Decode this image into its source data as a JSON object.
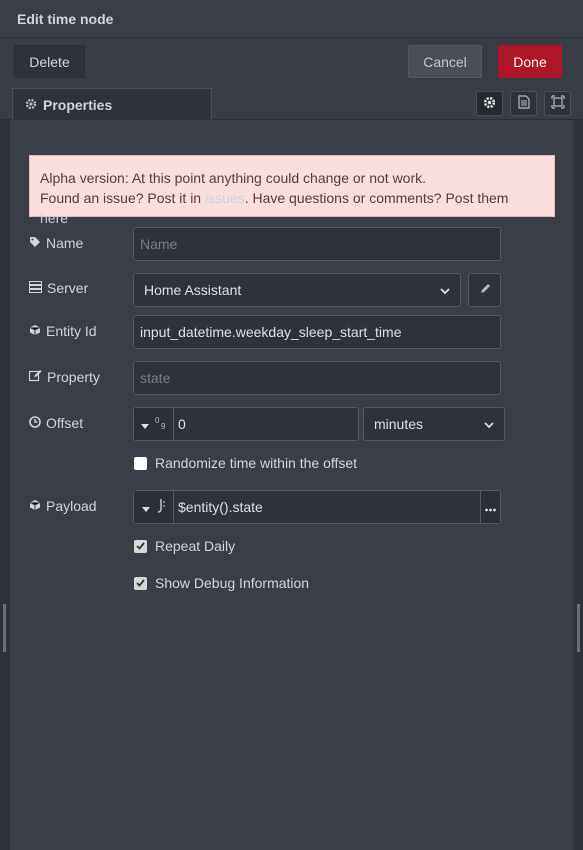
{
  "window": {
    "title": "Edit time node"
  },
  "toolbar": {
    "delete_label": "Delete",
    "cancel_label": "Cancel",
    "done_label": "Done"
  },
  "tabs": {
    "properties_label": "Properties"
  },
  "alert": {
    "line1": "Alpha version: At this point anything could change or not work.",
    "line2_a": "Found an issue? Post it in ",
    "issues_link": "issues",
    "line2_b": ". Have questions or comments? Post them ",
    "here_link": "here",
    "line2_c": "."
  },
  "fields": {
    "name": {
      "label": "Name",
      "placeholder": "Name"
    },
    "server": {
      "label": "Server",
      "value": "Home Assistant"
    },
    "entity_id": {
      "label": "Entity Id",
      "value": "input_datetime.weekday_sleep_start_time"
    },
    "property": {
      "label": "Property",
      "placeholder": "state"
    },
    "offset": {
      "label": "Offset",
      "value": "0",
      "unit": "minutes"
    },
    "payload": {
      "label": "Payload",
      "value": "$entity().state"
    }
  },
  "checks": {
    "randomize": {
      "label": "Randomize time within the offset",
      "checked": false
    },
    "repeat_daily": {
      "label": "Repeat Daily",
      "checked": true
    },
    "show_debug": {
      "label": "Show Debug Information",
      "checked": true
    }
  },
  "colors": {
    "done": "#ad1625",
    "alert_bg": "#fcdddd",
    "panel": "#3a3e47"
  }
}
